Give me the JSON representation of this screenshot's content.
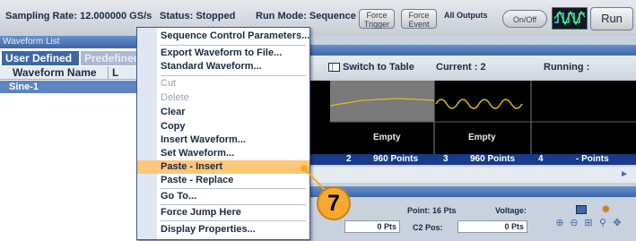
{
  "toolbar": {
    "sampling_rate": "Sampling Rate: 12.000000 GS/s",
    "status": "Status: Stopped",
    "run_mode": "Run Mode: Sequence",
    "force_trigger": "Force Trigger",
    "force_event": "Force Event",
    "all_outputs": "All Outputs",
    "on_off": "On/Off",
    "run": "Run"
  },
  "waveform_list": {
    "title": "Waveform List",
    "tabs": [
      "User Defined",
      "Predefined"
    ],
    "columns": [
      "Waveform Name",
      "L"
    ],
    "rows": [
      "Sine-1"
    ]
  },
  "sequence": {
    "switch_to_table": "Switch to Table",
    "current": "Current : 2",
    "running": "Running :",
    "cells": [
      "Empty",
      "Empty"
    ],
    "points": [
      {
        "index": "2",
        "text": "960 Points"
      },
      {
        "index": "3",
        "text": "960 Points"
      },
      {
        "index": "4",
        "text": "- Points"
      }
    ],
    "point_info": "Point: 16 Pts",
    "voltage": "Voltage:",
    "pts_value_1": "0 Pts",
    "c2_pos": "C2 Pos:",
    "pts_value_2": "0 Pts"
  },
  "context_menu": {
    "items": [
      {
        "label": "Sequence Control Parameters...",
        "enabled": true
      },
      {
        "label": "Export Waveform to File...",
        "enabled": true
      },
      {
        "label": "Standard Waveform...",
        "enabled": true
      },
      {
        "label": "Cut",
        "enabled": false
      },
      {
        "label": "Delete",
        "enabled": false
      },
      {
        "label": "Clear",
        "enabled": true
      },
      {
        "label": "Copy",
        "enabled": true
      },
      {
        "label": "Insert Waveform...",
        "enabled": true
      },
      {
        "label": "Set Waveform...",
        "enabled": true
      },
      {
        "label": "Paste - Insert",
        "enabled": true,
        "highlighted": true
      },
      {
        "label": "Paste - Replace",
        "enabled": true
      },
      {
        "label": "Go To...",
        "enabled": true
      },
      {
        "label": "Force Jump Here",
        "enabled": true
      },
      {
        "label": "Display Properties...",
        "enabled": true
      }
    ]
  },
  "callout": {
    "number": "7",
    "color": "#f7a92e"
  },
  "colors": {
    "highlight": "#ffc77a",
    "accent": "#3d67a8",
    "trace": "#e0c020"
  }
}
